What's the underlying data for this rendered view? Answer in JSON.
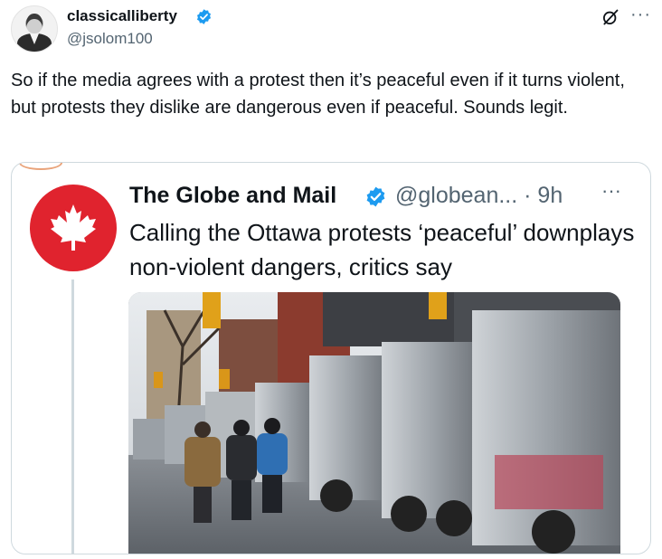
{
  "tweet": {
    "display_name": "classicalliberty",
    "handle": "@jsolom100",
    "text": "So if the media agrees with a protest then it’s peaceful even if it turns violent, but protests they dislike are dangerous even if peaceful. Sounds legit.",
    "more_label": "···"
  },
  "quote": {
    "display_name": "The Globe and Mail",
    "handle": "@globean... · 9h",
    "more_label": "···",
    "headline": "Calling the Ottawa protests ‘peaceful’ downplays non-violent dangers, critics say"
  },
  "colors": {
    "verified_blue": "#1d9bf0",
    "globe_red": "#e0232e",
    "text_primary": "#0f1419",
    "text_secondary": "#536471",
    "border": "#cfd9de"
  },
  "icons": {
    "avatar": "portrait-avatar",
    "verified": "verified-badge-icon",
    "grok": "grok-icon",
    "more": "more-icon",
    "logo": "maple-leaf-icon"
  }
}
